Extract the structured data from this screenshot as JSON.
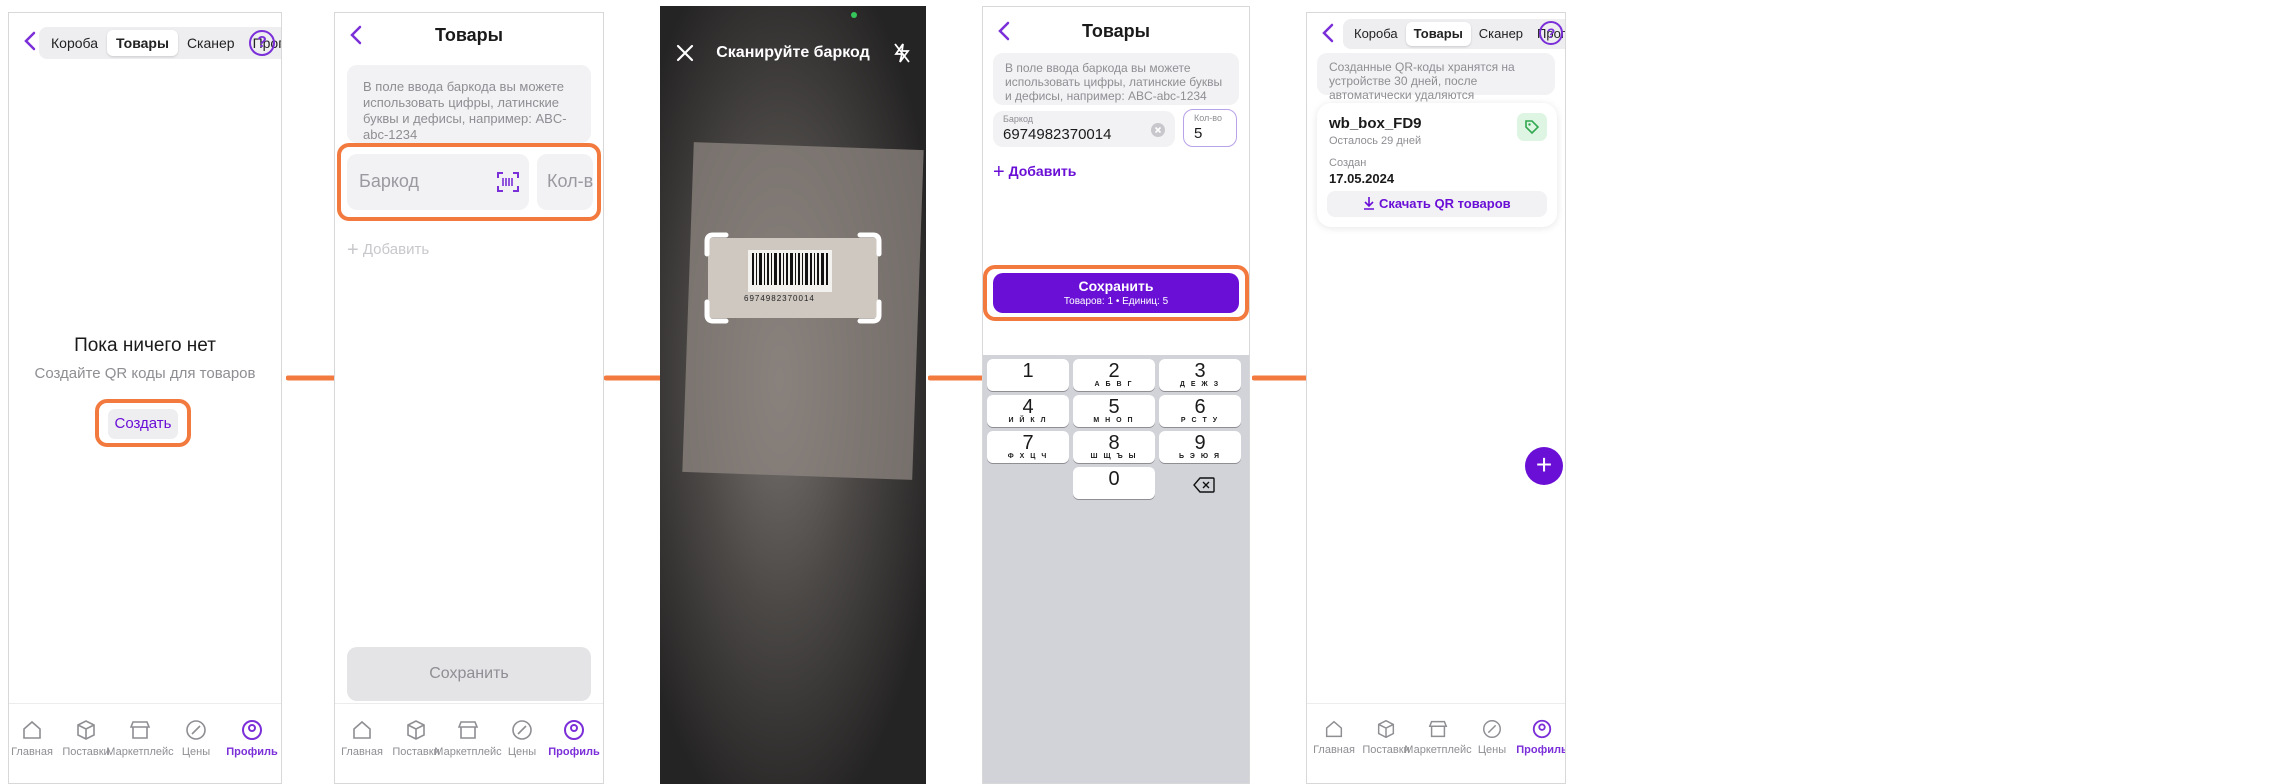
{
  "colors": {
    "accent": "#6a0fd6",
    "highlight": "#f37a3e",
    "muted": "#8e8e93"
  },
  "tabs": [
    "Короба",
    "Товары",
    "Сканер",
    "Пропус..."
  ],
  "help_label": "?",
  "nav": [
    "Главная",
    "Поставки",
    "Маркетплейс",
    "Цены",
    "Профиль"
  ],
  "screen1": {
    "empty_title": "Пока ничего нет",
    "empty_subtitle": "Создайте QR коды для товаров",
    "create_label": "Создать"
  },
  "screen2": {
    "title": "Товары",
    "hint": "В поле ввода баркода вы можете использовать цифры, латинские буквы и дефисы, например: ABC-abc-1234",
    "barcode_placeholder": "Баркод",
    "qty_placeholder": "Кол-во",
    "add_label": "Добавить",
    "save_label": "Сохранить"
  },
  "screen3": {
    "title": "Сканируйте баркод",
    "barcode_digits": "6974982370014"
  },
  "screen4": {
    "title": "Товары",
    "hint": "В поле ввода баркода вы можете использовать цифры, латинские буквы и дефисы, например: ABC-abc-1234",
    "barcode_label": "Баркод",
    "barcode_value": "6974982370014",
    "qty_label": "Кол-во",
    "qty_value": "5",
    "add_label": "Добавить",
    "save_label": "Сохранить",
    "save_sub": "Товаров: 1 • Единиц: 5",
    "keys": [
      {
        "n": "1",
        "l": ""
      },
      {
        "n": "2",
        "l": "А Б В Г"
      },
      {
        "n": "3",
        "l": "Д Е Ж З"
      },
      {
        "n": "4",
        "l": "И Й К Л"
      },
      {
        "n": "5",
        "l": "М Н О П"
      },
      {
        "n": "6",
        "l": "Р С Т У"
      },
      {
        "n": "7",
        "l": "Ф Х Ц Ч"
      },
      {
        "n": "8",
        "l": "Ш Щ Ъ Ы"
      },
      {
        "n": "9",
        "l": "Ь Э Ю Я"
      },
      {
        "n": "0",
        "l": ""
      }
    ]
  },
  "screen5": {
    "info": "Созданные QR-коды хранятся на устройстве 30 дней, после автоматически удаляются",
    "card_title": "wb_box_FD9",
    "card_sub": "Осталось 29 дней",
    "created_label": "Создан",
    "created_date": "17.05.2024",
    "download_label": "Скачать QR товаров"
  }
}
